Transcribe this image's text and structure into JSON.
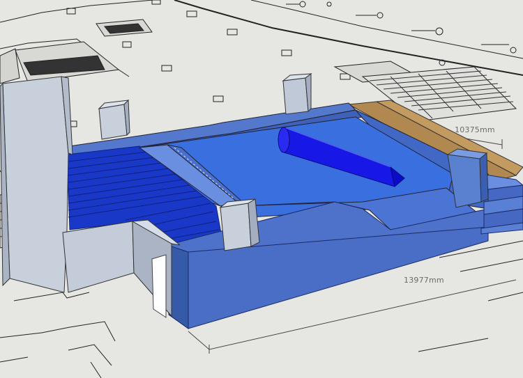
{
  "model": {
    "dimensions": {
      "width_label": "10375mm",
      "length_label": "13977mm"
    },
    "colors": {
      "ground": "#e6e6e3",
      "linework": "#222222",
      "pool_water": "#3a6fe0",
      "pool_blue_light": "#5a82d8",
      "pool_wall_front": "#4e72c9",
      "pool_wall_dark": "#345aa8",
      "grate_blue": "#1a38c8",
      "cylinder_blue": "#1818e6",
      "wood_deck": "#b08850",
      "concrete_light": "#c8d0dc",
      "concrete_mid": "#aab4c4"
    }
  }
}
